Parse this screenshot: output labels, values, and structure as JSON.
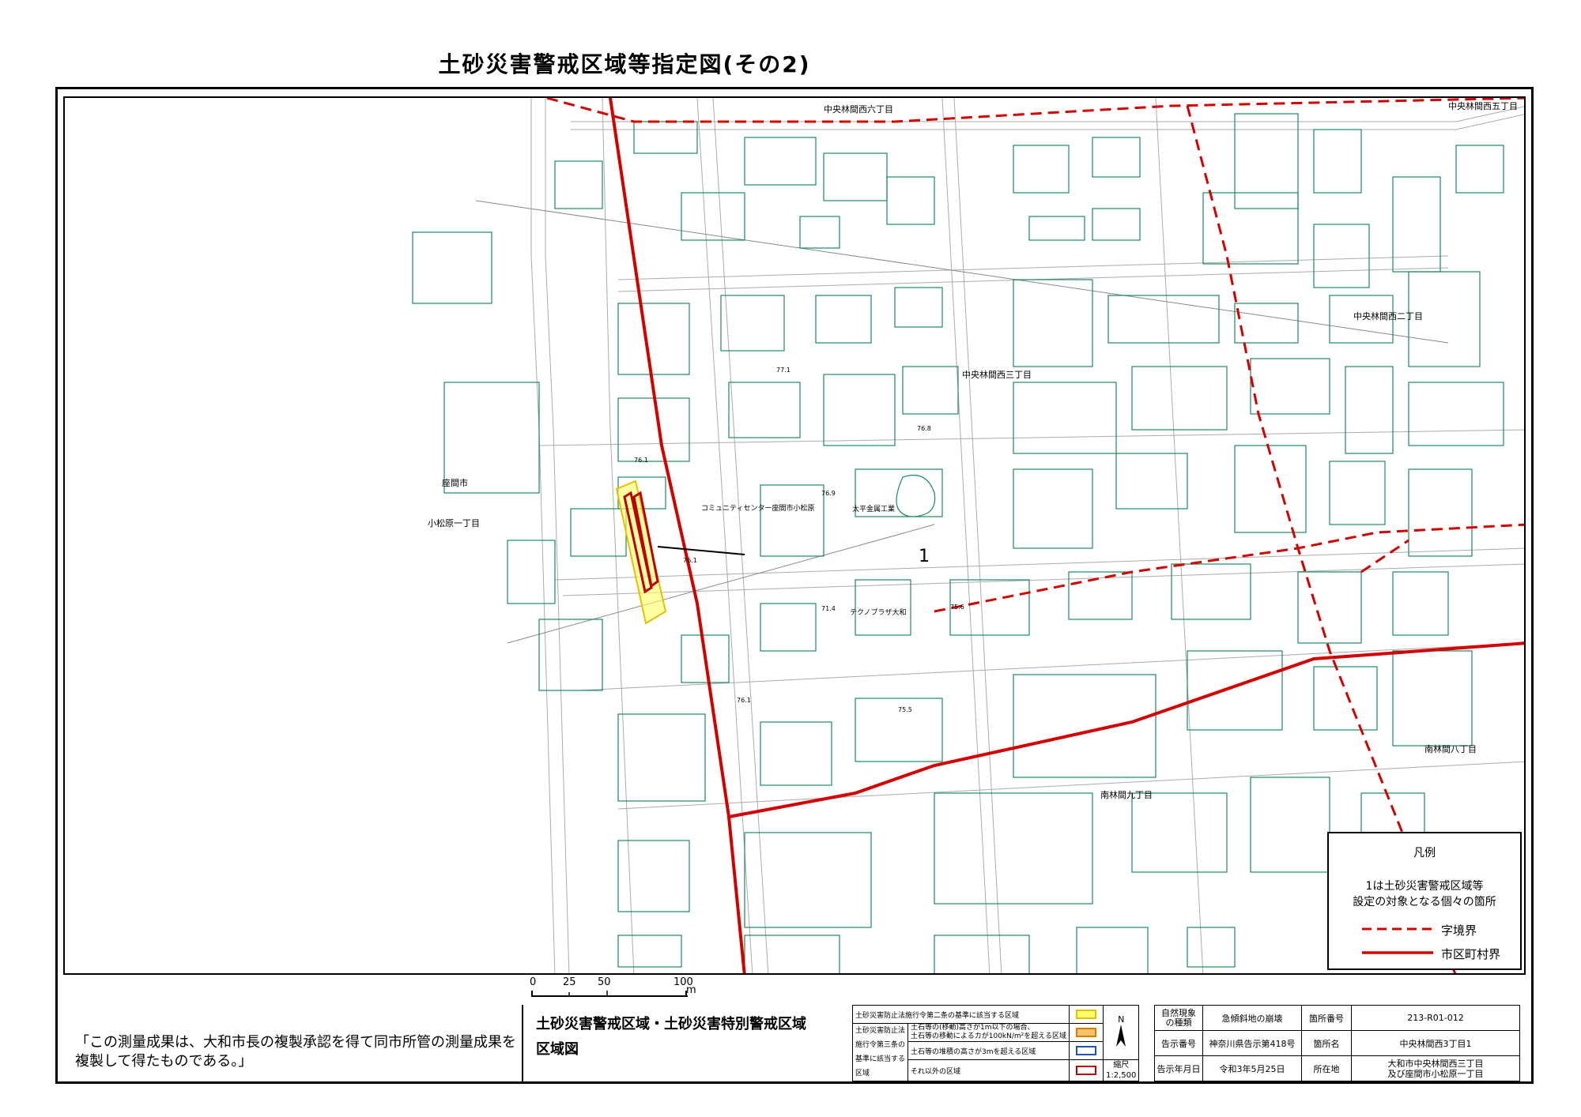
{
  "title": "土砂災害警戒区域等指定図(その2)",
  "map": {
    "labels": {
      "nishi6": "中央林間西六丁目",
      "nishi5": "中央林間西五丁目",
      "nishi2": "中央林間西二丁目",
      "nishi3": "中央林間西三丁目",
      "minami8": "南林間八丁目",
      "minami9": "南林間九丁目",
      "zama": "座間市",
      "komatsubara": "小松原一丁目",
      "community": "コミュニティセンター座間市小松原",
      "taihei": "太平金属工業",
      "techno": "テクノプラザ大和",
      "site_number": "1"
    },
    "elevations": [
      "77.1",
      "76.8",
      "76.1",
      "76.9",
      "76.1",
      "71.4",
      "75.6",
      "76.1",
      "75.5"
    ]
  },
  "legend": {
    "title": "凡例",
    "desc_line1": "1は土砂災害警戒区域等",
    "desc_line2": "設定の対象となる個々の箇所",
    "items": [
      {
        "label": "字境界",
        "style": "dashed",
        "color": "#d40000"
      },
      {
        "label": "市区町村界",
        "style": "solid",
        "color": "#d40000"
      }
    ]
  },
  "scalebar": {
    "labels": [
      "0",
      "25",
      "50",
      "100"
    ],
    "unit": "m"
  },
  "copyright": "「この測量成果は、大和市長の複製承認を得て同市所管の測量成果を複製して得たものである。」",
  "zone_table": {
    "title1": "土砂災害警戒区域・土砂災害特別警戒区域",
    "title2": "区域図",
    "row1": "土砂災害防止法施行令第二条の基準に該当する区域",
    "row2_head_a": "土砂災害防止法",
    "row2_head_b": "施行令第三条の",
    "row2_head_c": "基準に該当する",
    "row2_head_d": "区域",
    "row2a": "土石等の(移動)高さが1m以下の場合、",
    "row2b": "土石等の移動によるカが100kN/m²を超える区域",
    "row3": "土石等の堆積の高さが3mを超える区域",
    "row4": "それ以外の区域",
    "swatch_colors": [
      "#ffff66",
      "#f5c26b",
      "#ffffff",
      "#ffffff"
    ],
    "swatch_borders": [
      "#e6c000",
      "#d08000",
      "#2050c0",
      "#c00000"
    ],
    "north": "N",
    "scale_label": "縮尺",
    "scale_value": "1:2,500"
  },
  "info_table": {
    "phenomenon_label_a": "自然現象",
    "phenomenon_label_b": "の種類",
    "phenomenon_value": "急傾斜地の崩壊",
    "site_number_label": "箇所番号",
    "site_number_value": "213-R01-012",
    "notice_number_label": "告示番号",
    "notice_number_value": "神奈川県告示第418号",
    "site_name_label": "箇所名",
    "site_name_value": "中央林間西3丁目1",
    "notice_date_label": "告示年月日",
    "notice_date_value": "令和3年5月25日",
    "location_label": "所在地",
    "location_value_1": "大和市中央林間西三丁目",
    "location_value_2": "及び座間市小松原一丁目"
  }
}
